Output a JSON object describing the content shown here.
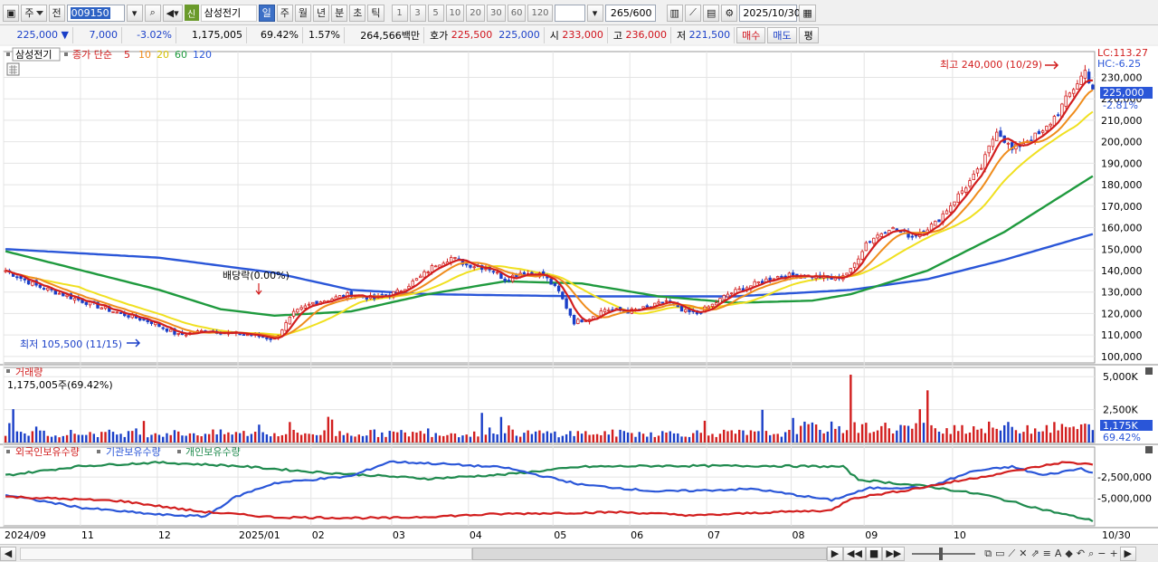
{
  "toolbar": {
    "menu_label": "주",
    "period_label": "전",
    "stock_code": "009150",
    "stock_name": "삼성전기",
    "badge": "신",
    "period_tabs": [
      "일",
      "주",
      "월",
      "년",
      "분",
      "초",
      "틱"
    ],
    "minute_nums": [
      "1",
      "3",
      "5",
      "10",
      "20",
      "30",
      "60",
      "120"
    ],
    "bar_count": "265",
    "bar_total": "/600",
    "date": "2025/10/30"
  },
  "quote": {
    "price": "225,000",
    "arrow": "▼",
    "change": "7,000",
    "rate": "-3.02%",
    "volume": "1,175,005",
    "vol_rate": "69.42%",
    "turnover_rate": "1.57%",
    "amount": "264,566백만",
    "ask_label": "호가",
    "ask": "225,500",
    "bid": "225,000",
    "open_label": "시",
    "open": "233,000",
    "high_label": "고",
    "high": "236,000",
    "low_label": "저",
    "low": "221,500",
    "buy_label": "매수",
    "sell_label": "매도",
    "avg_label": "평"
  },
  "chart_data": {
    "type": "candlestick",
    "price_panel": {
      "stock_label": "삼성전기",
      "series_label": "종가 단순",
      "ma_periods": [
        "5",
        "10",
        "20",
        "60",
        "120"
      ],
      "ma_colors": {
        "5": "#d21e1e",
        "10": "#ef8c1c",
        "20": "#f0e020",
        "60": "#1f9a3e",
        "120": "#2a56d8"
      },
      "ylim": [
        97000,
        242000
      ],
      "yticks": [
        100000,
        110000,
        120000,
        130000,
        140000,
        150000,
        160000,
        170000,
        180000,
        190000,
        200000,
        210000,
        220000,
        230000
      ],
      "ytick_labels": [
        "100,000",
        "110,000",
        "120,000",
        "130,000",
        "140,000",
        "150,000",
        "160,000",
        "170,000",
        "180,000",
        "190,000",
        "200,000",
        "210,000",
        "220,000",
        "230,000"
      ],
      "lc_label": "LC:113.27",
      "hc_label": "HC:-6.25",
      "current_price_label": "225,000",
      "current_change_label": "-2.81%",
      "high_annotation": "최고 240,000 (10/29)",
      "low_annotation": "최저 105,500 (11/15)",
      "dividend_annotation": "배당락(0.00%)",
      "close_anchors": [
        [
          0,
          140000
        ],
        [
          8,
          133000
        ],
        [
          18,
          127000
        ],
        [
          28,
          121000
        ],
        [
          38,
          116000
        ],
        [
          45,
          110000
        ],
        [
          52,
          112000
        ],
        [
          58,
          111000
        ],
        [
          64,
          110000
        ],
        [
          70,
          108000
        ],
        [
          75,
          120000
        ],
        [
          80,
          125000
        ],
        [
          85,
          127000
        ],
        [
          90,
          129000
        ],
        [
          96,
          127000
        ],
        [
          102,
          130000
        ],
        [
          108,
          137000
        ],
        [
          112,
          143000
        ],
        [
          116,
          146000
        ],
        [
          120,
          143000
        ],
        [
          126,
          141000
        ],
        [
          130,
          136000
        ],
        [
          134,
          139000
        ],
        [
          140,
          138000
        ],
        [
          144,
          130000
        ],
        [
          148,
          116000
        ],
        [
          152,
          118000
        ],
        [
          156,
          122000
        ],
        [
          162,
          121000
        ],
        [
          168,
          123000
        ],
        [
          172,
          126000
        ],
        [
          176,
          121000
        ],
        [
          180,
          120000
        ],
        [
          184,
          124000
        ],
        [
          188,
          129000
        ],
        [
          194,
          133000
        ],
        [
          200,
          137000
        ],
        [
          206,
          138000
        ],
        [
          212,
          137000
        ],
        [
          216,
          136000
        ],
        [
          220,
          140000
        ],
        [
          224,
          153000
        ],
        [
          230,
          160000
        ],
        [
          236,
          156000
        ],
        [
          242,
          162000
        ],
        [
          248,
          175000
        ],
        [
          254,
          188000
        ],
        [
          258,
          206000
        ],
        [
          262,
          196000
        ],
        [
          266,
          201000
        ],
        [
          270,
          204000
        ],
        [
          274,
          214000
        ],
        [
          278,
          225000
        ],
        [
          281,
          233000
        ],
        [
          283,
          225000
        ]
      ],
      "ma_anchors": {
        "60": [
          [
            0,
            149000
          ],
          [
            20,
            140000
          ],
          [
            40,
            131000
          ],
          [
            56,
            122000
          ],
          [
            70,
            119000
          ],
          [
            90,
            121000
          ],
          [
            110,
            129000
          ],
          [
            130,
            135000
          ],
          [
            150,
            134000
          ],
          [
            170,
            128000
          ],
          [
            190,
            125000
          ],
          [
            210,
            126000
          ],
          [
            220,
            129000
          ],
          [
            240,
            140000
          ],
          [
            260,
            158000
          ],
          [
            283,
            184000
          ]
        ],
        "120": [
          [
            0,
            150000
          ],
          [
            40,
            146000
          ],
          [
            70,
            139000
          ],
          [
            90,
            131000
          ],
          [
            110,
            129000
          ],
          [
            150,
            128000
          ],
          [
            190,
            128000
          ],
          [
            220,
            131000
          ],
          [
            240,
            136000
          ],
          [
            260,
            145000
          ],
          [
            283,
            157000
          ]
        ]
      },
      "n_days": 284
    },
    "volume_panel": {
      "title": "거래량",
      "current_label": "1,175,005주(69.42%)",
      "yticks": [
        2500000,
        5000000
      ],
      "ytick_labels": [
        "2,500K",
        "5,000K"
      ],
      "ylim": [
        0,
        5700000
      ],
      "current_value_label": "1,175K",
      "current_rate_label": "69.42%",
      "spike_day": 220,
      "spike_value": 5150000
    },
    "holdings_panel": {
      "series": [
        {
          "name": "외국인보유수량",
          "color": "#d21e1e"
        },
        {
          "name": "기관보유수량",
          "color": "#2a56d8"
        },
        {
          "name": "개인보유수량",
          "color": "#1f8a4e"
        }
      ],
      "yticks": [
        -2500000,
        -5000000
      ],
      "ytick_labels": [
        "-2,500,000",
        "-5,000,000"
      ],
      "ylim": [
        -8200000,
        1000000
      ],
      "foreign": [
        [
          0,
          -4800000
        ],
        [
          30,
          -5300000
        ],
        [
          50,
          -6500000
        ],
        [
          70,
          -7200000
        ],
        [
          100,
          -7300000
        ],
        [
          130,
          -6800000
        ],
        [
          160,
          -6600000
        ],
        [
          180,
          -7000000
        ],
        [
          200,
          -6600000
        ],
        [
          215,
          -6400000
        ],
        [
          220,
          -5000000
        ],
        [
          235,
          -4000000
        ],
        [
          250,
          -2800000
        ],
        [
          265,
          -1600000
        ],
        [
          275,
          -800000
        ],
        [
          283,
          -1000000
        ]
      ],
      "institution": [
        [
          0,
          -4600000
        ],
        [
          20,
          -6100000
        ],
        [
          40,
          -6900000
        ],
        [
          52,
          -7100000
        ],
        [
          60,
          -4800000
        ],
        [
          70,
          -3200000
        ],
        [
          90,
          -2400000
        ],
        [
          100,
          -700000
        ],
        [
          115,
          -1000000
        ],
        [
          130,
          -1400000
        ],
        [
          150,
          -3400000
        ],
        [
          170,
          -4200000
        ],
        [
          195,
          -3900000
        ],
        [
          215,
          -5200000
        ],
        [
          225,
          -3800000
        ],
        [
          240,
          -3700000
        ],
        [
          252,
          -1800000
        ],
        [
          262,
          -1300000
        ],
        [
          270,
          -2300000
        ],
        [
          280,
          -1500000
        ],
        [
          283,
          -2000000
        ]
      ],
      "individual": [
        [
          0,
          -2300000
        ],
        [
          20,
          -1200000
        ],
        [
          40,
          -800000
        ],
        [
          60,
          -1200000
        ],
        [
          80,
          -1900000
        ],
        [
          110,
          -2700000
        ],
        [
          130,
          -2200000
        ],
        [
          150,
          -1300000
        ],
        [
          170,
          -1200000
        ],
        [
          200,
          -1200000
        ],
        [
          218,
          -1300000
        ],
        [
          222,
          -2800000
        ],
        [
          240,
          -3600000
        ],
        [
          255,
          -4600000
        ],
        [
          270,
          -6300000
        ],
        [
          283,
          -7600000
        ]
      ]
    },
    "x_axis": {
      "labels": [
        "2024/09",
        "11",
        "12",
        "2025/01",
        "02",
        "03",
        "04",
        "05",
        "06",
        "07",
        "08",
        "09",
        "10"
      ],
      "label_days": [
        0,
        20,
        40,
        61,
        80,
        101,
        121,
        143,
        163,
        183,
        205,
        224,
        247
      ],
      "end_label": "10/30"
    }
  },
  "bottom": {
    "icons": [
      "play-right-icon",
      "rewind-icon",
      "stop-icon",
      "fast-forward-icon"
    ]
  }
}
